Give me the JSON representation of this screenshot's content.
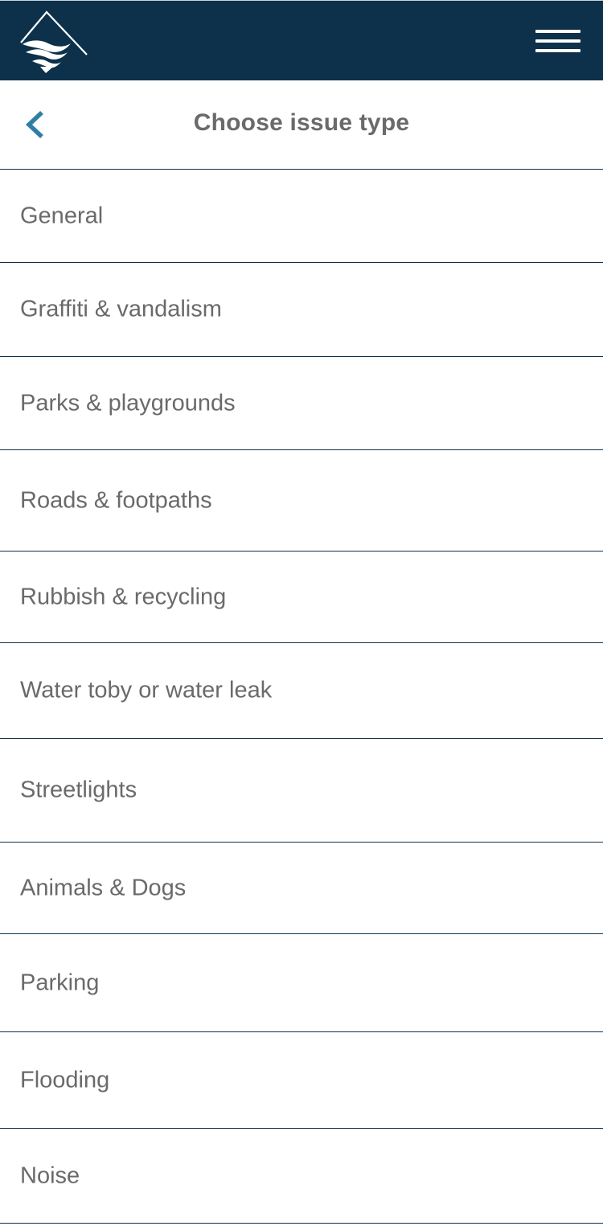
{
  "header": {
    "logo_icon": "mountain-wave-logo-icon",
    "menu_icon": "hamburger-menu-icon",
    "background_color": "#0d314b"
  },
  "title_bar": {
    "back_icon": "chevron-left-icon",
    "back_icon_color": "#2f7fa5",
    "title": "Choose issue type"
  },
  "issue_types": [
    {
      "label": "General"
    },
    {
      "label": "Graffiti & vandalism"
    },
    {
      "label": "Parks & playgrounds"
    },
    {
      "label": "Roads & footpaths"
    },
    {
      "label": "Rubbish & recycling"
    },
    {
      "label": "Water toby or water leak"
    },
    {
      "label": "Streetlights"
    },
    {
      "label": "Animals & Dogs"
    },
    {
      "label": "Parking"
    },
    {
      "label": "Flooding"
    },
    {
      "label": "Noise"
    }
  ]
}
